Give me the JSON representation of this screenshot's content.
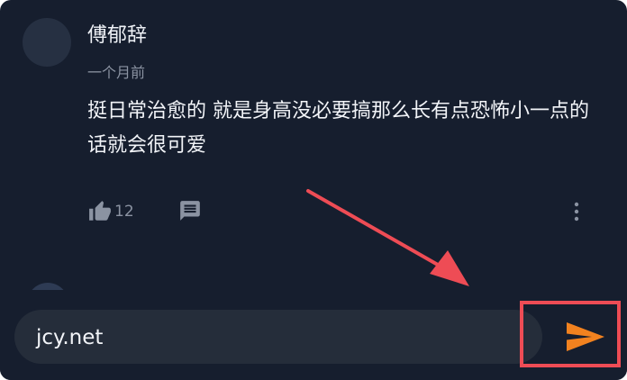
{
  "comment": {
    "username": "傅郁辞",
    "time": "一个月前",
    "body": "挺日常治愈的 就是身高没必要搞那么长有点恐怖小一点的话就会很可爱",
    "like_count": "12"
  },
  "input": {
    "value": "jcy.net"
  },
  "colors": {
    "background": "#161e2e",
    "input_background": "#252d3a",
    "send_accent": "#f2821f",
    "highlight_red": "#ee4c55"
  },
  "icons": [
    "avatar",
    "thumbs-up-icon",
    "reply-icon",
    "more-vert-icon",
    "send-icon"
  ]
}
